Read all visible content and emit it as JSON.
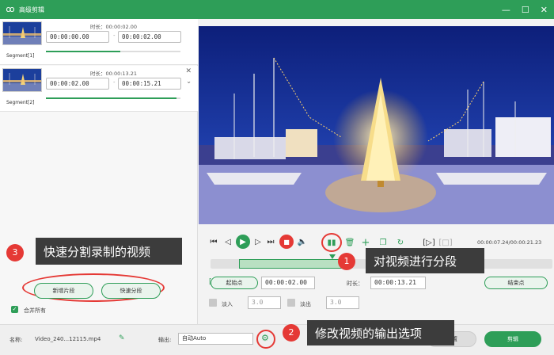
{
  "window": {
    "title": "高级剪辑"
  },
  "segments": [
    {
      "label": "Segment[1]",
      "duration_label": "时长：",
      "duration": "00:00:02.00",
      "start": "00:00:00.00",
      "end": "00:00:02.00",
      "progress": 0.55
    },
    {
      "label": "Segment[2]",
      "duration_label": "时长：",
      "duration": "00:00:13.21",
      "start": "00:00:02.00",
      "end": "00:00:15.21",
      "progress": 0.97
    }
  ],
  "callouts": {
    "c1": {
      "num": "1",
      "text": "对视频进行分段"
    },
    "c2": {
      "num": "2",
      "text": "修改视频的输出选项"
    },
    "c3": {
      "num": "3",
      "text": "快速分割录制的视频"
    }
  },
  "left_buttons": {
    "new_segment": "新增片段",
    "quick_split": "快速分段"
  },
  "merge_all": {
    "label": "合并所有",
    "checked": true
  },
  "player": {
    "time_current": "00:00:07.24",
    "time_total": "00:00:21.23"
  },
  "clip": {
    "start_label": "起始点",
    "start_value": "00:00:02.00",
    "duration_label": "时长：",
    "duration_value": "00:00:13.21",
    "end_label": "结束点",
    "fade_in_label": "淡入",
    "fade_in_value": "3.0",
    "fade_out_label": "淡出",
    "fade_out_value": "3.0"
  },
  "bottom": {
    "name_label": "名称:",
    "name_value": "Video_240...12115.mp4",
    "output_label": "输出:",
    "output_value": "自动Auto",
    "reset_label": "重置",
    "cut_label": "剪辑"
  },
  "colors": {
    "accent": "#2e9e58",
    "highlight": "#e53935",
    "callout_bg": "#3c3c3c"
  },
  "icons": [
    "app-logo-icon",
    "minimize-icon",
    "maximize-icon",
    "close-icon",
    "play-icon",
    "stop-icon",
    "split-icon",
    "delete-icon",
    "add-icon",
    "copy-icon",
    "rotate-icon",
    "volume-icon",
    "gear-icon",
    "edit-icon"
  ]
}
